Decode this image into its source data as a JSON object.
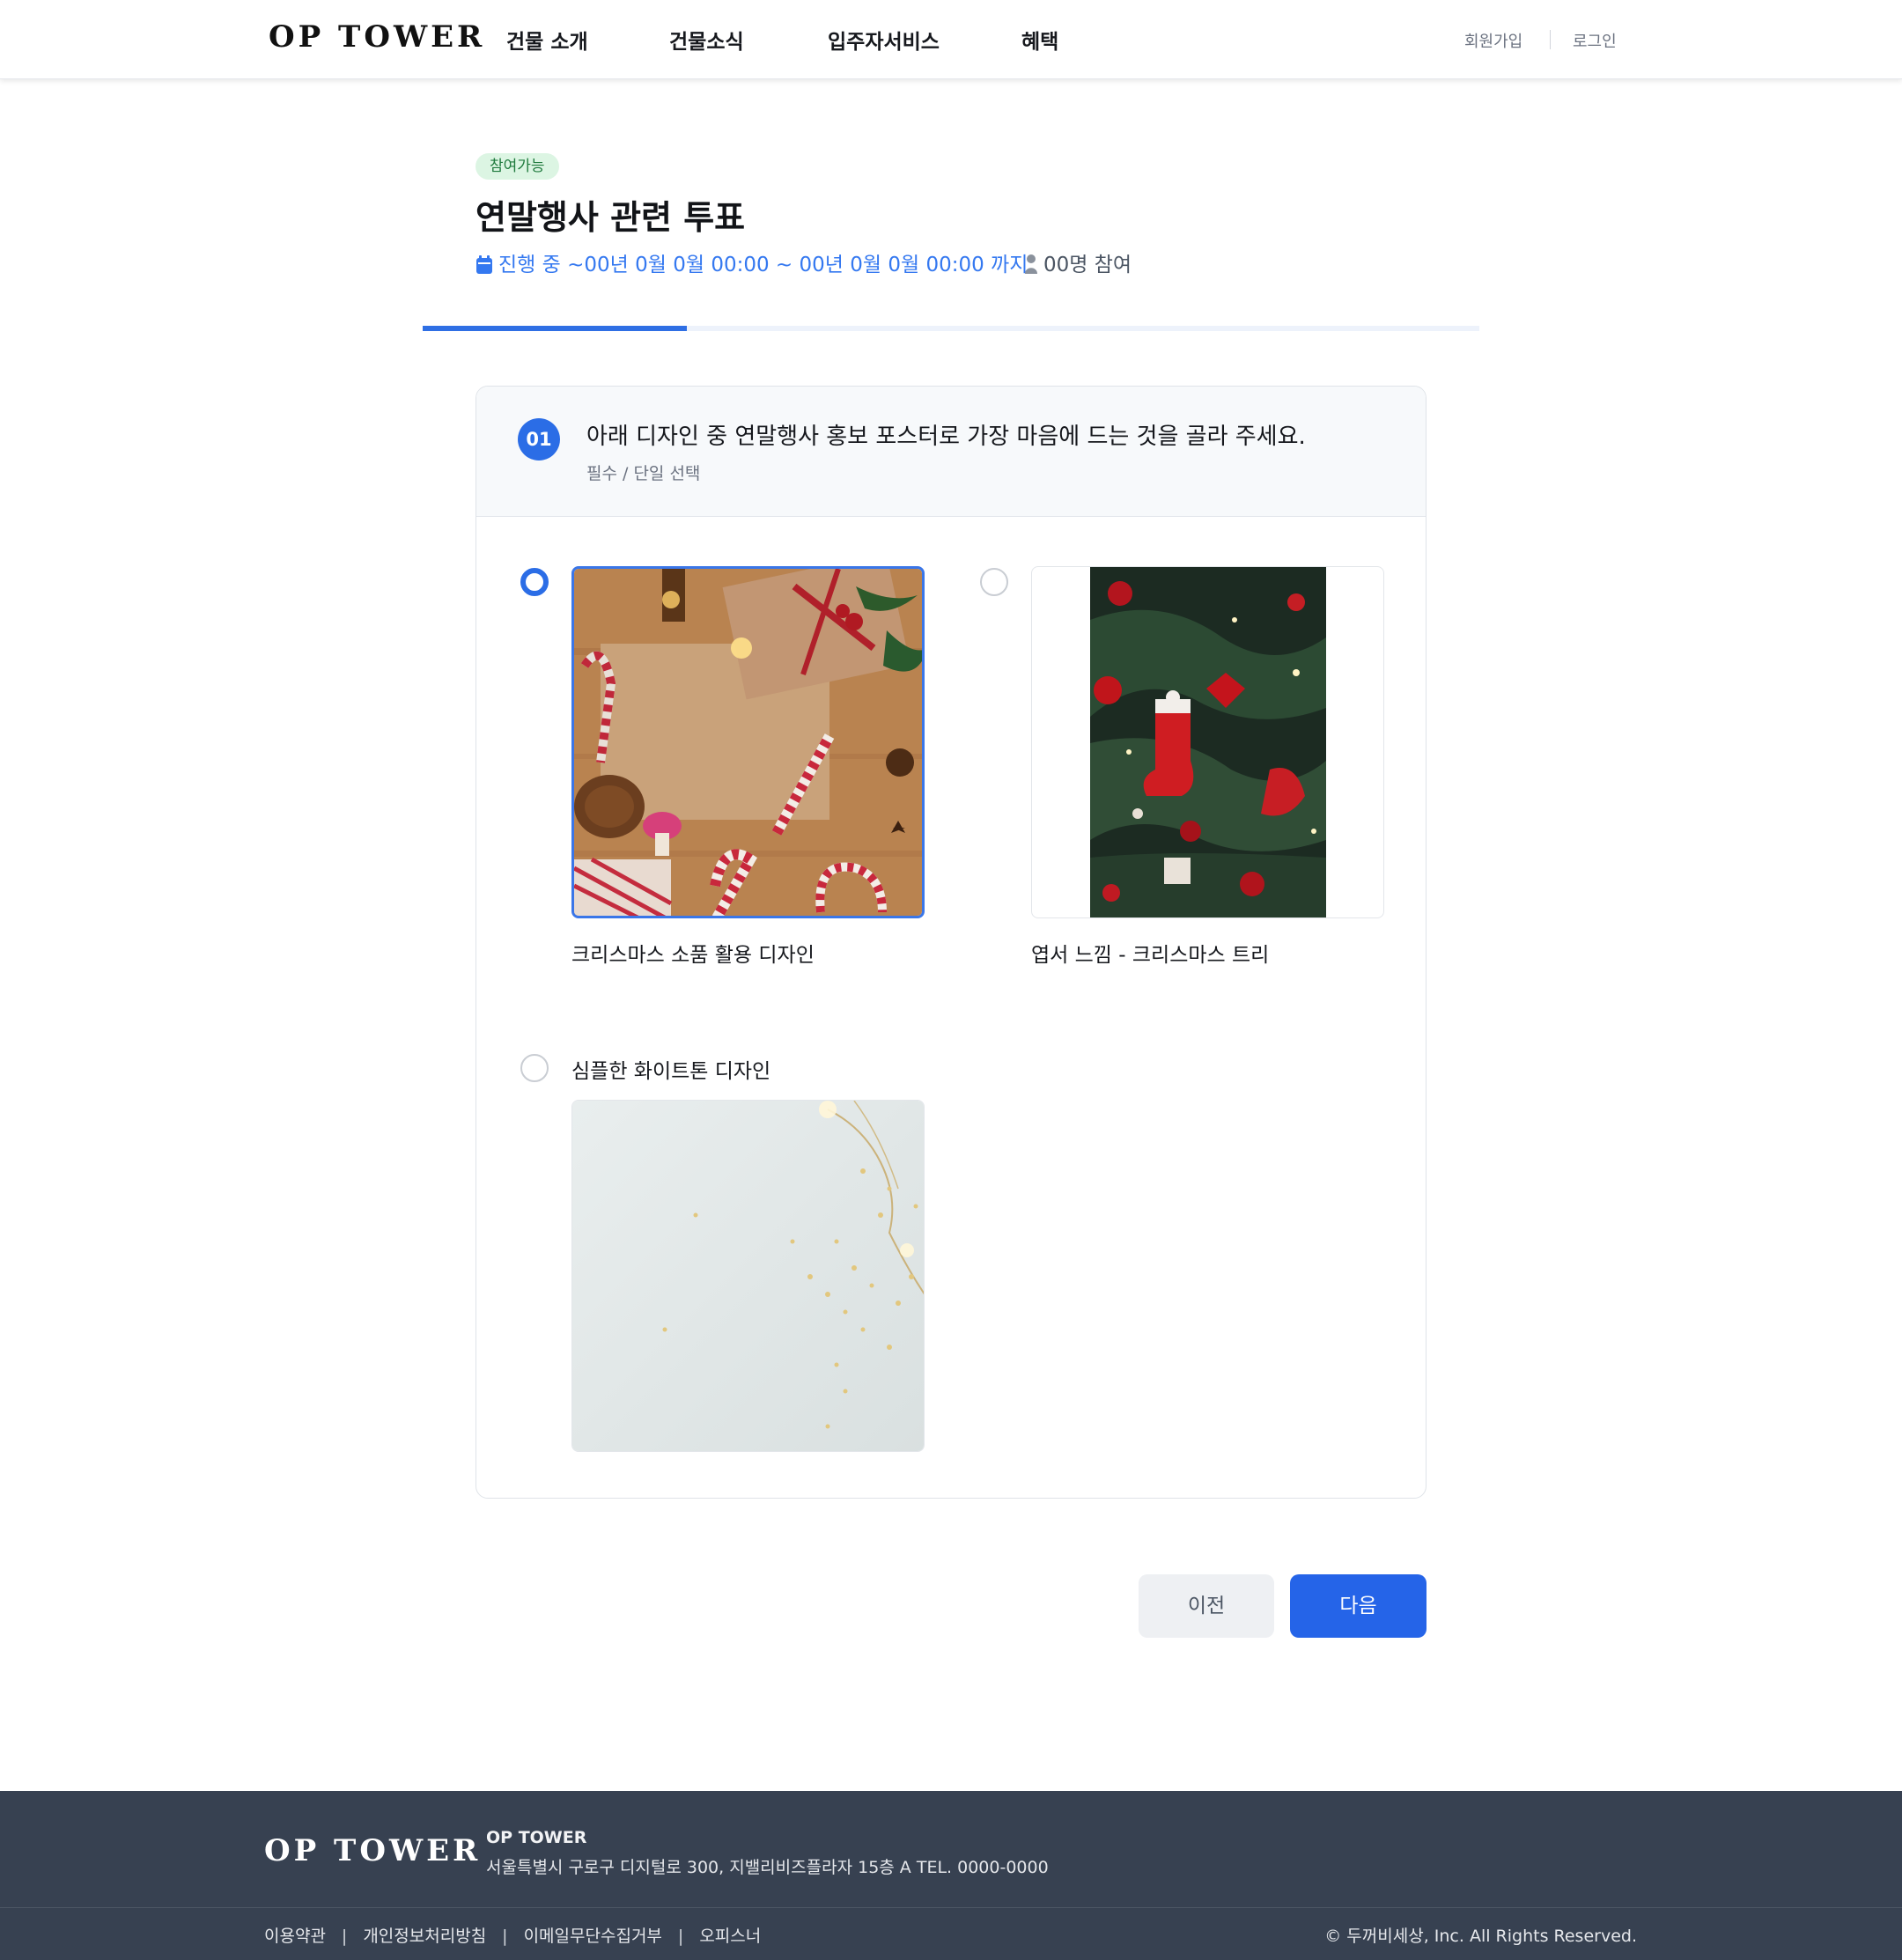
{
  "header": {
    "logo": "OP TOWER",
    "nav": [
      "건물 소개",
      "건물소식",
      "입주자서비스",
      "혜택"
    ],
    "signup": "회원가입",
    "login": "로그인"
  },
  "poll": {
    "badge": "참여가능",
    "title": "연말행사 관련 투표",
    "period": "진행 중 ~00년 0월 0월 00:00 ~ 00년 0월 0월 00:00 까지",
    "participants": "00명 참여",
    "progress_fraction": 0.25
  },
  "question": {
    "number": "01",
    "text": "아래 디자인 중 연말행사 홍보 포스터로 가장 마음에 드는 것을 골라 주세요.",
    "subtext": "필수 / 단일 선택",
    "options": [
      {
        "label": "크리스마스 소품 활용 디자인",
        "selected": true
      },
      {
        "label": "엽서 느낌 - 크리스마스 트리",
        "selected": false
      },
      {
        "label": "심플한 화이트톤 디자인",
        "selected": false
      }
    ]
  },
  "buttons": {
    "prev": "이전",
    "next": "다음"
  },
  "colors": {
    "accent": "#2564e8",
    "badge_bg": "#dcf5e3",
    "footer_bg": "#374151"
  },
  "footer": {
    "logo": "OP TOWER",
    "company": "OP TOWER",
    "address": "서울특별시 구로구 디지털로 300, 지밸리비즈플라자 15층 A    TEL. 0000-0000",
    "links": [
      "이용약관",
      "개인정보처리방침",
      "이메일무단수집거부",
      "오피스너"
    ],
    "copyright": "© 두꺼비세상, Inc. All Rights Reserved."
  }
}
